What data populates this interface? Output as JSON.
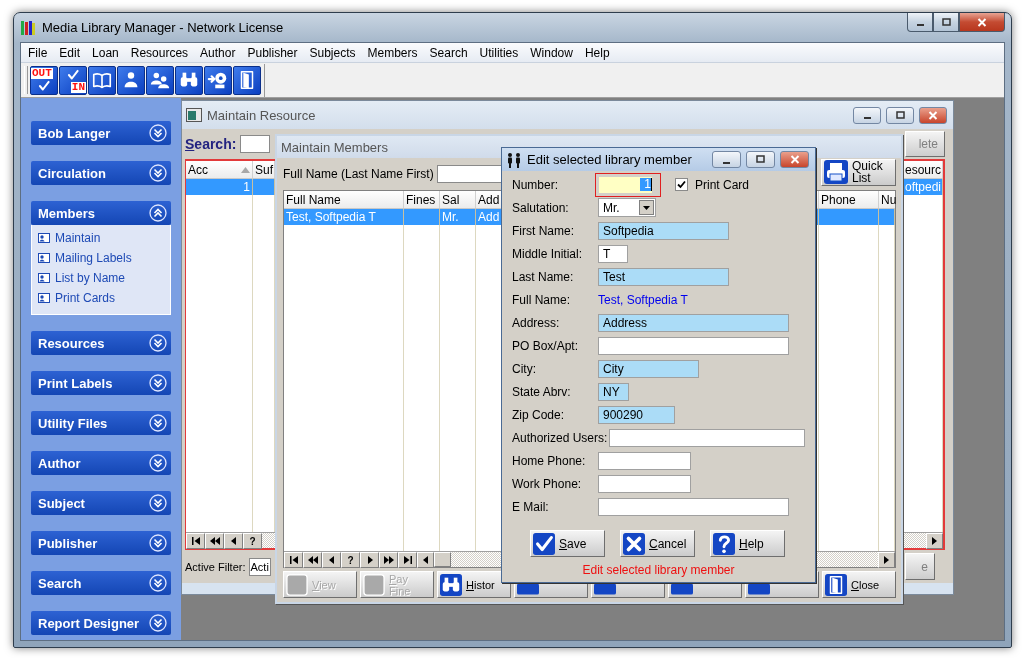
{
  "window": {
    "title": "Media Library Manager - Network License"
  },
  "menu": [
    "File",
    "Edit",
    "Loan",
    "Resources",
    "Author",
    "Publisher",
    "Subjects",
    "Members",
    "Search",
    "Utilities",
    "Window",
    "Help"
  ],
  "toolbar": [
    {
      "kind": "out",
      "label": "OUT"
    },
    {
      "kind": "in",
      "label": "IN"
    },
    {
      "kind": "book"
    },
    {
      "kind": "person"
    },
    {
      "kind": "people"
    },
    {
      "kind": "binoculars"
    },
    {
      "kind": "disk"
    },
    {
      "kind": "door"
    }
  ],
  "sidebar": [
    {
      "title": "Bob Langer",
      "expanded": false
    },
    {
      "title": "Circulation",
      "expanded": false
    },
    {
      "title": "Members",
      "expanded": true,
      "items": [
        "Maintain",
        "Mailing Labels",
        "List by Name",
        "Print Cards"
      ]
    },
    {
      "title": "Resources",
      "expanded": false
    },
    {
      "title": "Print Labels",
      "expanded": false
    },
    {
      "title": "Utility Files",
      "expanded": false
    },
    {
      "title": "Author",
      "expanded": false
    },
    {
      "title": "Subject",
      "expanded": false
    },
    {
      "title": "Publisher",
      "expanded": false
    },
    {
      "title": "Search",
      "expanded": false
    },
    {
      "title": "Report Designer",
      "expanded": false
    }
  ],
  "maintain_resource": {
    "title": "Maintain Resource",
    "search_label": "Search:",
    "delete_button": "lete",
    "columns": [
      {
        "label": "Acc",
        "sorted": true
      },
      {
        "label": "Suf"
      },
      {
        "label": "esourc"
      }
    ],
    "rows": [
      {
        "cells": [
          "1",
          "",
          "oftpedi"
        ],
        "selected": true
      }
    ],
    "nav": [
      {
        "kind": "first"
      },
      {
        "kind": "prev_page"
      },
      {
        "kind": "prev"
      },
      {
        "kind": "find",
        "label": "?"
      }
    ],
    "active_filter_label": "Active Filter:",
    "active_filter_value": "Acti",
    "right_button": "e"
  },
  "maintain_members": {
    "title": "Maintain Members",
    "search_label": "Full Name (Last Name First)",
    "quick_list_button": "Quick List",
    "columns": [
      "Full Name",
      "Fines",
      "Sal",
      "Add",
      "Phone",
      "Nu"
    ],
    "rows": [
      {
        "cells": [
          "Test, Softpedia T",
          "",
          "Mr.",
          "Add",
          "",
          ""
        ],
        "selected": true
      }
    ],
    "nav": [
      {
        "kind": "first"
      },
      {
        "kind": "prev_page"
      },
      {
        "kind": "prev"
      },
      {
        "kind": "find",
        "label": "?"
      },
      {
        "kind": "next"
      },
      {
        "kind": "next_page"
      },
      {
        "kind": "last"
      }
    ],
    "buttons": [
      {
        "kind": "view",
        "label": "View",
        "disabled": true,
        "mnemonic": true
      },
      {
        "kind": "pay_fine",
        "label": "Pay Fine",
        "disabled": true,
        "mnemonic": true
      },
      {
        "kind": "history",
        "label": "Histor",
        "disabled": false,
        "mnemonic": true
      },
      {
        "kind": "add",
        "disabled": false
      },
      {
        "kind": "edit",
        "disabled": false
      },
      {
        "kind": "delete",
        "disabled": false
      },
      {
        "kind": "help",
        "disabled": false
      },
      {
        "kind": "close",
        "label": "Close",
        "disabled": false,
        "mnemonic": true
      }
    ]
  },
  "dialog": {
    "title": "Edit selected library member",
    "fields": [
      {
        "kind": "number",
        "label": "Number:",
        "value": "1",
        "focused": true,
        "checkbox": {
          "label": "Print Card",
          "checked": true
        }
      },
      {
        "kind": "select",
        "label": "Salutation:",
        "value": "Mr."
      },
      {
        "kind": "text",
        "label": "First Name:",
        "value": "Softpedia",
        "required": true
      },
      {
        "kind": "text",
        "label": "Middle Initial:",
        "value": "T",
        "required": false
      },
      {
        "kind": "text",
        "label": "Last Name:",
        "value": "Test",
        "required": true
      },
      {
        "kind": "display",
        "label": "Full Name:",
        "value": "Test, Softpedia T"
      },
      {
        "kind": "text",
        "label": "Address:",
        "value": "Address",
        "required": true
      },
      {
        "kind": "text",
        "label": "PO Box/Apt:",
        "required": false
      },
      {
        "kind": "text",
        "label": "City:",
        "value": "City",
        "required": true
      },
      {
        "kind": "text",
        "label": "State Abrv:",
        "value": "NY",
        "required": true
      },
      {
        "kind": "text",
        "label": "Zip Code:",
        "value": "900290",
        "required": true
      },
      {
        "kind": "text",
        "label": "Authorized Users:",
        "required": false
      },
      {
        "kind": "text",
        "label": "Home Phone:",
        "required": false
      },
      {
        "kind": "text",
        "label": "Work Phone:",
        "required": false
      },
      {
        "kind": "text",
        "label": "E Mail:",
        "required": false
      }
    ],
    "buttons": [
      {
        "kind": "save",
        "label": "Save",
        "mnemonic": true
      },
      {
        "kind": "cancel",
        "label": "Cancel",
        "mnemonic": true
      },
      {
        "kind": "help",
        "label": "Help",
        "mnemonic": true
      }
    ],
    "status": "Edit selected library member"
  }
}
